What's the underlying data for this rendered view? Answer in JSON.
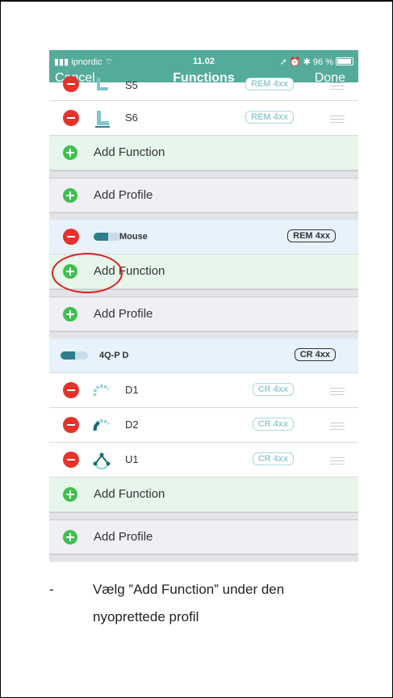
{
  "status_bar": {
    "carrier": "ipnordic",
    "time": "11.02",
    "battery": "96 %"
  },
  "nav": {
    "cancel": "Cancel",
    "title": "Functions",
    "done": "Done"
  },
  "rows": {
    "s5": {
      "label": "S5",
      "badge": "REM 4xx"
    },
    "s6": {
      "label": "S6",
      "badge": "REM 4xx"
    },
    "add_function_1": "Add Function",
    "add_profile_1": "Add Profile",
    "mouse_profile": {
      "label": "Mouse",
      "badge": "REM 4xx"
    },
    "add_function_2": "Add Function",
    "add_profile_2": "Add Profile",
    "profile_4q": {
      "label": "4Q-P D",
      "badge": "CR 4xx"
    },
    "d1": {
      "label": "D1",
      "badge": "CR 4xx"
    },
    "d2": {
      "label": "D2",
      "badge": "CR 4xx"
    },
    "u1": {
      "label": "U1",
      "badge": "CR 4xx"
    },
    "add_function_3": "Add Function",
    "add_profile_3": "Add Profile"
  },
  "caption": {
    "bullet": "-",
    "text": "Vælg ”Add Function” under den nyoprettede profil"
  },
  "colors": {
    "nav": "#55ab9b",
    "minus": "#e5322b",
    "plus": "#3fbf4f",
    "highlight": "#d92120"
  }
}
